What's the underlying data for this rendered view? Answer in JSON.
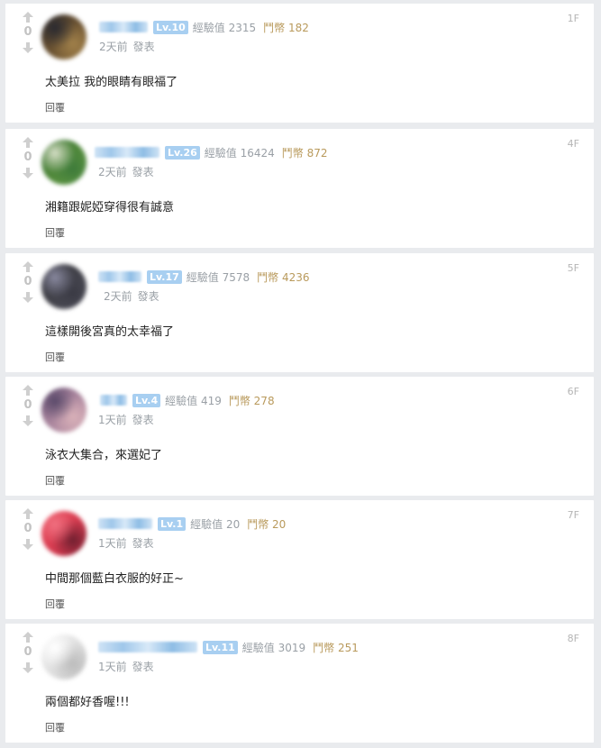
{
  "colors": {
    "page_bg": "#e9ebee",
    "card_bg": "#ffffff",
    "level_badge": "#a8cff1",
    "meta_gray": "#9aa0a6",
    "coin_gold": "#b99a5c"
  },
  "comments": [
    {
      "floor": "1F",
      "votes": "0",
      "level": "Lv.10",
      "exp": "經驗值 2315",
      "coins": "鬥幣 182",
      "time": "2天前",
      "action": "發表",
      "text": "太美拉 我的眼睛有眼福了",
      "reply": "回覆",
      "avatar_colors": [
        "#4a3a2a",
        "#8a6a3a",
        "#2a2a30",
        "#a0804a"
      ]
    },
    {
      "floor": "4F",
      "votes": "0",
      "level": "Lv.26",
      "exp": "經驗值 16424",
      "coins": "鬥幣 872",
      "time": "2天前",
      "action": "發表",
      "text": "湘籍跟妮婭穿得很有誠意",
      "reply": "回覆",
      "avatar_colors": [
        "#2f6a2a",
        "#6fa54a",
        "#d8e0c8",
        "#3d7a3a"
      ]
    },
    {
      "floor": "5F",
      "votes": "0",
      "level": "Lv.17",
      "exp": "經驗值 7578",
      "coins": "鬥幣 4236",
      "time": "2天前",
      "action": "發表",
      "text": "這樣開後宮真的太幸福了",
      "reply": "回覆",
      "avatar_colors": [
        "#2a2a2e",
        "#5a5a66",
        "#8a8aa0",
        "#3a3a44"
      ]
    },
    {
      "floor": "6F",
      "votes": "0",
      "level": "Lv.4",
      "exp": "經驗值 419",
      "coins": "鬥幣 278",
      "time": "1天前",
      "action": "發表",
      "text": "泳衣大集合，來選妃了",
      "reply": "回覆",
      "avatar_colors": [
        "#8a6a8a",
        "#c9a0b0",
        "#5a4a6a",
        "#d8b0b8"
      ]
    },
    {
      "floor": "7F",
      "votes": "0",
      "level": "Lv.1",
      "exp": "經驗值 20",
      "coins": "鬥幣 20",
      "time": "1天前",
      "action": "發表",
      "text": "中間那個藍白衣服的好正~",
      "reply": "回覆",
      "avatar_colors": [
        "#e84a5a",
        "#c83048",
        "#f07080",
        "#702030"
      ]
    },
    {
      "floor": "8F",
      "votes": "0",
      "level": "Lv.11",
      "exp": "經驗值 3019",
      "coins": "鬥幣 251",
      "time": "1天前",
      "action": "發表",
      "text": "兩個都好香喔!!!",
      "reply": "回覆",
      "avatar_colors": [
        "#f0f0f0",
        "#d0d0d0",
        "#ffffff",
        "#bcbcbc"
      ]
    }
  ]
}
